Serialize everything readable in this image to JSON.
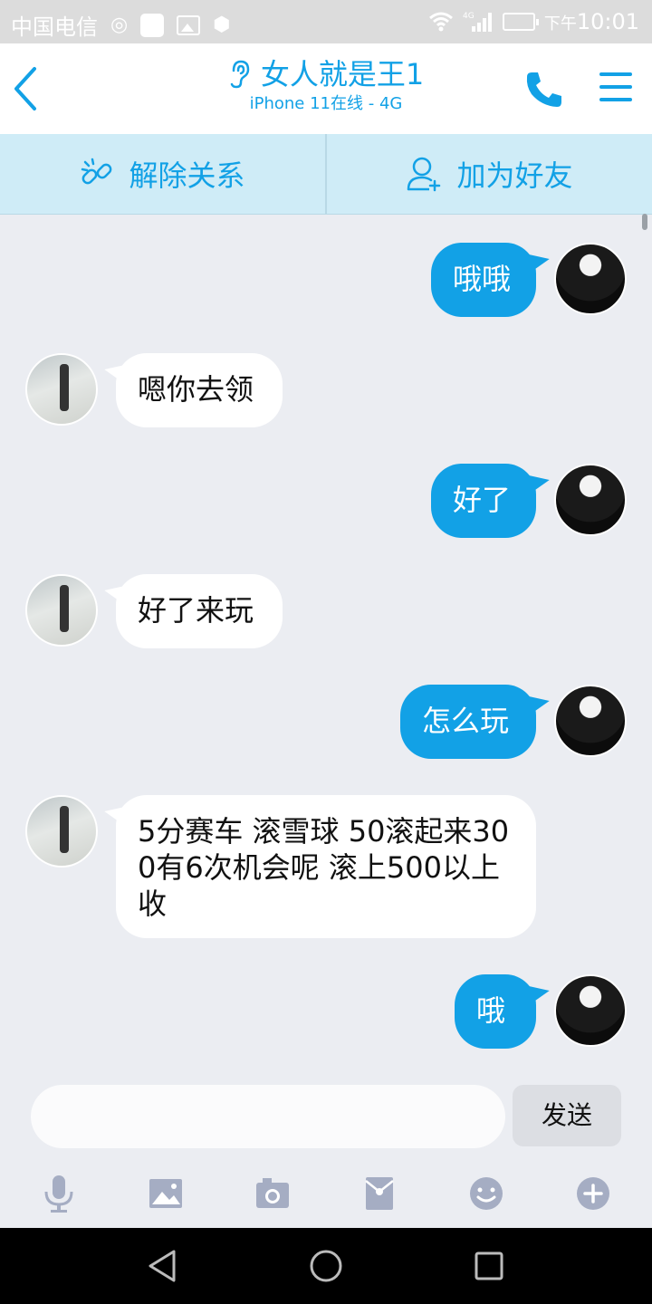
{
  "status_bar": {
    "carrier": "中国电信",
    "network": "4G",
    "time_prefix": "下午",
    "time": "10:01"
  },
  "header": {
    "title": "女人就是王1",
    "subtitle": "iPhone 11在线 - 4G",
    "icons": [
      "back-icon",
      "ear-icon",
      "phone-icon",
      "menu-icon"
    ]
  },
  "actions": {
    "unlink_label": "解除关系",
    "add_friend_label": "加为好友"
  },
  "messages": [
    {
      "side": "mine",
      "text": "哦哦"
    },
    {
      "side": "theirs",
      "text": "嗯你去领"
    },
    {
      "side": "mine",
      "text": "好了"
    },
    {
      "side": "theirs",
      "text": "好了来玩"
    },
    {
      "side": "mine",
      "text": "怎么玩"
    },
    {
      "side": "theirs",
      "text": "5分赛车 滚雪球  50滚起来300有6次机会呢 滚上500以上收"
    },
    {
      "side": "mine",
      "text": "哦"
    }
  ],
  "composer": {
    "input_value": "",
    "send_label": "发送"
  },
  "toolbar_icons": [
    "microphone-icon",
    "image-icon",
    "camera-icon",
    "red-packet-icon",
    "emoji-icon",
    "plus-icon"
  ],
  "colors": {
    "accent": "#12a1e6",
    "chat_background": "#ebedf2",
    "action_bar": "#cfecf7"
  }
}
